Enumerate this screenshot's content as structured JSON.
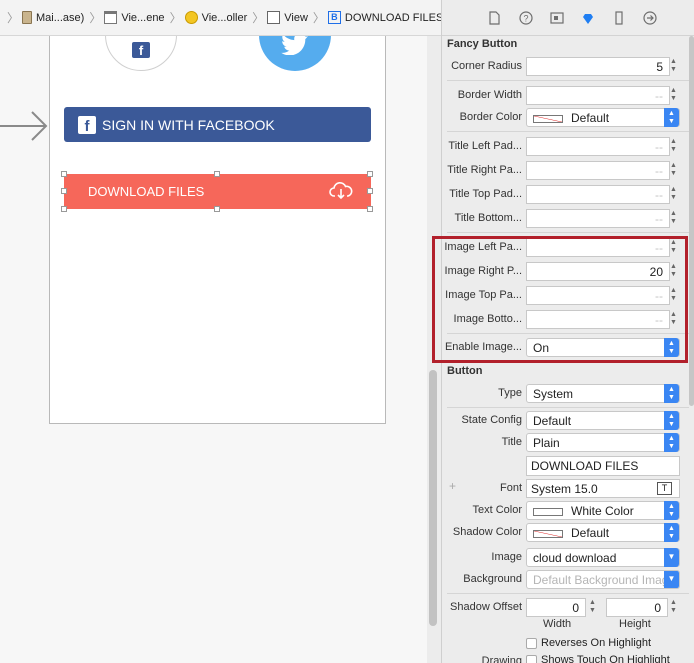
{
  "jumpbar": {
    "crumbs": [
      "Mai...ase)",
      "Vie...ene",
      "Vie...oller",
      "View",
      "DOWNLOAD FILES"
    ]
  },
  "canvas": {
    "fb_button_label": "SIGN IN WITH FACEBOOK",
    "download_button_label": "DOWNLOAD FILES",
    "colors": {
      "facebook": "#3b5998",
      "twitter": "#55acee",
      "download": "#f6675a"
    }
  },
  "inspector": {
    "fancy_title": "Fancy Button",
    "corner_radius": {
      "label": "Corner Radius",
      "value": "5"
    },
    "border_width": {
      "label": "Border Width",
      "value": "--"
    },
    "border_color": {
      "label": "Border Color",
      "value": "Default"
    },
    "title_left": {
      "label": "Title Left Pad...",
      "value": "--"
    },
    "title_right": {
      "label": "Title Right Pa...",
      "value": "--"
    },
    "title_top": {
      "label": "Title Top Pad...",
      "value": "--"
    },
    "title_bottom": {
      "label": "Title Bottom...",
      "value": "--"
    },
    "image_left": {
      "label": "Image Left Pa...",
      "value": "--"
    },
    "image_right": {
      "label": "Image Right P...",
      "value": "20"
    },
    "image_top": {
      "label": "Image Top Pa...",
      "value": "--"
    },
    "image_bottom": {
      "label": "Image Botto...",
      "value": "--"
    },
    "enable_image": {
      "label": "Enable Image...",
      "value": "On"
    },
    "button_title": "Button",
    "type": {
      "label": "Type",
      "value": "System"
    },
    "state_config": {
      "label": "State Config",
      "value": "Default"
    },
    "title": {
      "label": "Title",
      "value": "Plain",
      "text": "DOWNLOAD FILES"
    },
    "font": {
      "label": "Font",
      "value": "System 15.0",
      "icon": "T"
    },
    "text_color": {
      "label": "Text Color",
      "value": "White Color"
    },
    "shadow_color": {
      "label": "Shadow Color",
      "value": "Default"
    },
    "image": {
      "label": "Image",
      "value": "cloud download"
    },
    "background": {
      "label": "Background",
      "placeholder": "Default Background Imag"
    },
    "shadow_offset": {
      "label": "Shadow Offset",
      "width": "0",
      "height": "0",
      "width_label": "Width",
      "height_label": "Height"
    },
    "reverses": {
      "label": "Reverses On Highlight"
    },
    "drawing": {
      "label": "Drawing",
      "value": "Shows Touch On Highlight"
    }
  },
  "icons": [
    "file-icon",
    "help-icon",
    "identity-icon",
    "attributes-icon",
    "size-icon",
    "connections-icon",
    "cloud-download-icon",
    "twitter-icon",
    "facebook-icon"
  ]
}
